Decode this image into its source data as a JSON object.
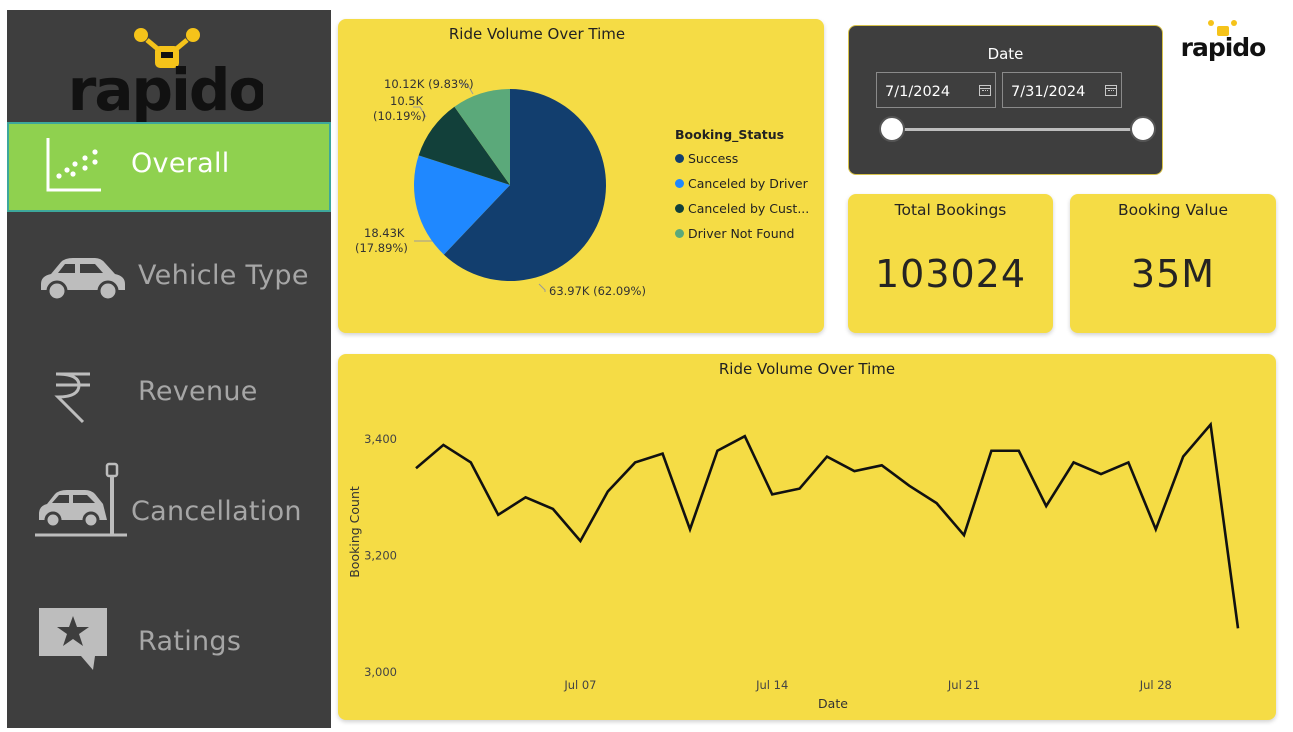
{
  "sidebar": {
    "logo_text": "rapido",
    "items": [
      {
        "label": "Overall",
        "icon": "scatter-chart-icon",
        "active": true
      },
      {
        "label": "Vehicle Type",
        "icon": "car-icon",
        "active": false
      },
      {
        "label": "Revenue",
        "icon": "rupee-icon",
        "active": false
      },
      {
        "label": "Cancellation",
        "icon": "car-crash-icon",
        "active": false
      },
      {
        "label": "Ratings",
        "icon": "star-chat-icon",
        "active": false
      }
    ]
  },
  "pie_card": {
    "title": "Ride Volume Over Time",
    "legend_title": "Booking_Status",
    "labels": {
      "success": "63.97K (62.09%)",
      "canceled_driver_value": "18.43K",
      "canceled_driver_pct": "(17.89%)",
      "canceled_customer_value": "10.5K",
      "canceled_customer_pct": "(10.19%)",
      "driver_not_found": "10.12K (9.83%)"
    }
  },
  "date_slicer": {
    "title": "Date",
    "start": "7/1/2024",
    "end": "7/31/2024"
  },
  "brand_logo_text": "rapido",
  "kpis": {
    "total_bookings": {
      "title": "Total Bookings",
      "value": "103024"
    },
    "booking_value": {
      "title": "Booking Value",
      "value": "35M"
    }
  },
  "line_card": {
    "title": "Ride Volume Over Time"
  },
  "colors": {
    "sidebar_bg": "#3e3e3e",
    "active_nav": "#8fd14f",
    "card_bg": "#f5dc45",
    "success": "#123e6e",
    "canceled_driver": "#1f88ff",
    "canceled_customer": "#12403a",
    "driver_not_found": "#5ba97a"
  },
  "chart_data": [
    {
      "type": "pie",
      "title": "Ride Volume Over Time",
      "legend_title": "Booking_Status",
      "legend_placement": "right",
      "slices": [
        {
          "name": "Success",
          "legend_label": "Success",
          "value": 63970,
          "pct": 62.09,
          "color": "#123e6e"
        },
        {
          "name": "Canceled by Driver",
          "legend_label": "Canceled by Driver",
          "value": 18430,
          "pct": 17.89,
          "color": "#1f88ff"
        },
        {
          "name": "Canceled by Customer",
          "legend_label": "Canceled by Cust...",
          "value": 10500,
          "pct": 10.19,
          "color": "#12403a"
        },
        {
          "name": "Driver Not Found",
          "legend_label": "Driver Not Found",
          "value": 10120,
          "pct": 9.83,
          "color": "#5ba97a"
        }
      ]
    },
    {
      "type": "line",
      "title": "Ride Volume Over Time",
      "xlabel": "Date",
      "ylabel": "Booking Count",
      "ylim": [
        3000,
        3450
      ],
      "yticks": [
        3000,
        3200,
        3400
      ],
      "ytick_labels": [
        "3,000",
        "3,200",
        "3,400"
      ],
      "xtick_labels": [
        "Jul 07",
        "Jul 14",
        "Jul 21",
        "Jul 28"
      ],
      "xticks": [
        "2024-07-07",
        "2024-07-14",
        "2024-07-21",
        "2024-07-28"
      ],
      "xlim": [
        "2024-07-01",
        "2024-07-31"
      ],
      "grid": false,
      "x": [
        "2024-07-01",
        "2024-07-02",
        "2024-07-03",
        "2024-07-04",
        "2024-07-05",
        "2024-07-06",
        "2024-07-07",
        "2024-07-08",
        "2024-07-09",
        "2024-07-10",
        "2024-07-11",
        "2024-07-12",
        "2024-07-13",
        "2024-07-14",
        "2024-07-15",
        "2024-07-16",
        "2024-07-17",
        "2024-07-18",
        "2024-07-19",
        "2024-07-20",
        "2024-07-21",
        "2024-07-22",
        "2024-07-23",
        "2024-07-24",
        "2024-07-25",
        "2024-07-26",
        "2024-07-27",
        "2024-07-28",
        "2024-07-29",
        "2024-07-30",
        "2024-07-31"
      ],
      "series": [
        {
          "values": [
            3350,
            3390,
            3360,
            3270,
            3300,
            3280,
            3225,
            3310,
            3360,
            3375,
            3245,
            3380,
            3405,
            3305,
            3315,
            3370,
            3345,
            3355,
            3320,
            3290,
            3235,
            3380,
            3380,
            3285,
            3360,
            3340,
            3360,
            3245,
            3370,
            3425,
            3075
          ],
          "color": "#111111"
        }
      ]
    }
  ]
}
